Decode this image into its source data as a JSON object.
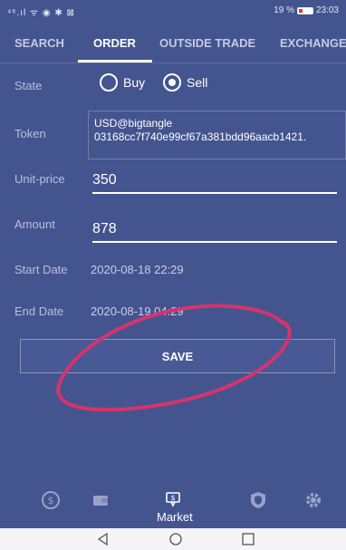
{
  "status": {
    "left_icons": "⁴⁶.ıl ᯤ ◉ ✱ ⊠",
    "battery": "19 %",
    "time": "23:03"
  },
  "tabs": [
    {
      "label": "SEARCH"
    },
    {
      "label": "ORDER"
    },
    {
      "label": "OUTSIDE TRADE"
    },
    {
      "label": "EXCHANGE"
    }
  ],
  "form": {
    "state_label": "State",
    "buy_label": "Buy",
    "sell_label": "Sell",
    "selected_state": "Sell",
    "token_label": "Token",
    "token_line1": "USD@bigtangle",
    "token_line2": "03168cc7f740e99cf67a381bdd96aacb1421.",
    "unit_price_label": "Unit-price",
    "unit_price_value": "350",
    "amount_label": "Amount",
    "amount_value": "878",
    "start_date_label": "Start Date",
    "start_date_value": "2020-08-18 22:29",
    "end_date_label": "End Date",
    "end_date_value": "2020-08-19 04:29",
    "save_label": "SAVE"
  },
  "bottom_nav": {
    "items": [
      {
        "icon": "dollar-circle-icon"
      },
      {
        "icon": "wallet-icon"
      },
      {
        "icon": "market-icon",
        "label": "Market"
      },
      {
        "icon": "shield-icon"
      },
      {
        "icon": "gear-icon"
      }
    ]
  },
  "system_nav": [
    "back-icon",
    "home-icon",
    "recents-icon"
  ],
  "colors": {
    "background": "#44548f",
    "annotation": "#d6336c",
    "system_bar": "#f5f5f7"
  }
}
